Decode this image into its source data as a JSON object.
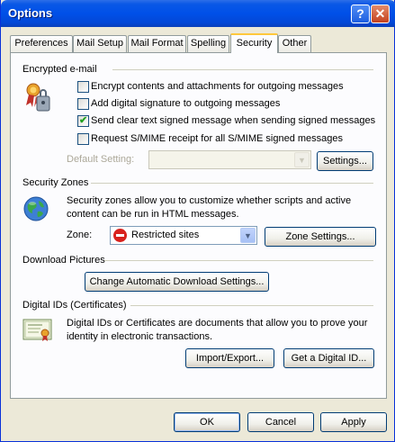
{
  "window": {
    "title": "Options"
  },
  "titlebar": {
    "help_label": "?",
    "close_label": "✕"
  },
  "tabs": [
    {
      "label": "Preferences"
    },
    {
      "label": "Mail Setup"
    },
    {
      "label": "Mail Format"
    },
    {
      "label": "Spelling"
    },
    {
      "label": "Security"
    },
    {
      "label": "Other"
    }
  ],
  "encrypted_email": {
    "heading": "Encrypted e-mail",
    "options": [
      {
        "label": "Encrypt contents and attachments for outgoing messages",
        "checked": false
      },
      {
        "label": "Add digital signature to outgoing messages",
        "checked": false
      },
      {
        "label": "Send clear text signed message when sending signed messages",
        "checked": true
      },
      {
        "label": "Request S/MIME receipt for all S/MIME signed messages",
        "checked": false
      }
    ],
    "default_setting_label": "Default Setting:",
    "default_setting_value": "",
    "settings_button": "Settings..."
  },
  "security_zones": {
    "heading": "Security Zones",
    "description": "Security zones allow you to customize whether scripts and active content can be run in HTML messages.",
    "zone_label": "Zone:",
    "zone_value": "Restricted sites",
    "zone_settings_button": "Zone Settings..."
  },
  "download_pictures": {
    "heading": "Download Pictures",
    "button": "Change Automatic Download Settings..."
  },
  "digital_ids": {
    "heading": "Digital IDs (Certificates)",
    "description": "Digital IDs or Certificates are documents that allow you to prove your identity in electronic transactions.",
    "import_export_button": "Import/Export...",
    "get_id_button": "Get a Digital ID..."
  },
  "footer": {
    "ok": "OK",
    "cancel": "Cancel",
    "apply": "Apply"
  }
}
